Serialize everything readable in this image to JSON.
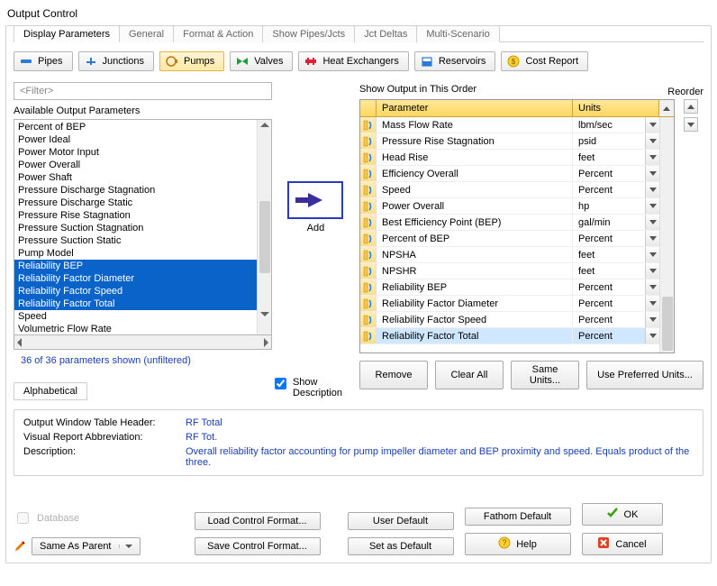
{
  "window": {
    "title": "Output Control"
  },
  "topTabs": [
    {
      "label": "Display Parameters",
      "active": true
    },
    {
      "label": "General",
      "active": false
    },
    {
      "label": "Format & Action",
      "active": false
    },
    {
      "label": "Show Pipes/Jcts",
      "active": false
    },
    {
      "label": "Jct Deltas",
      "active": false
    },
    {
      "label": "Multi-Scenario",
      "active": false
    }
  ],
  "categories": [
    {
      "label": "Pipes",
      "icon": "pipes-icon",
      "active": false
    },
    {
      "label": "Junctions",
      "icon": "junctions-icon",
      "active": false
    },
    {
      "label": "Pumps",
      "icon": "pump-icon",
      "active": true
    },
    {
      "label": "Valves",
      "icon": "valves-icon",
      "active": false
    },
    {
      "label": "Heat Exchangers",
      "icon": "heat-exchanger-icon",
      "active": false
    },
    {
      "label": "Reservoirs",
      "icon": "reservoir-icon",
      "active": false
    },
    {
      "label": "Cost Report",
      "icon": "cost-report-icon",
      "active": false
    }
  ],
  "filter": {
    "placeholder": "<Filter>"
  },
  "available": {
    "label": "Available Output Parameters",
    "items": [
      {
        "text": "Percent of BEP",
        "selected": false
      },
      {
        "text": "Power Ideal",
        "selected": false
      },
      {
        "text": "Power Motor Input",
        "selected": false
      },
      {
        "text": "Power Overall",
        "selected": false
      },
      {
        "text": "Power Shaft",
        "selected": false
      },
      {
        "text": "Pressure Discharge Stagnation",
        "selected": false
      },
      {
        "text": "Pressure Discharge Static",
        "selected": false
      },
      {
        "text": "Pressure Rise Stagnation",
        "selected": false
      },
      {
        "text": "Pressure Suction Stagnation",
        "selected": false
      },
      {
        "text": "Pressure Suction Static",
        "selected": false
      },
      {
        "text": "Pump Model",
        "selected": false
      },
      {
        "text": "Reliability BEP",
        "selected": true
      },
      {
        "text": "Reliability Factor Diameter",
        "selected": true
      },
      {
        "text": "Reliability Factor Speed",
        "selected": true
      },
      {
        "text": "Reliability Factor Total",
        "selected": true
      },
      {
        "text": "Speed",
        "selected": false
      },
      {
        "text": "Volumetric Flow Rate",
        "selected": false
      }
    ],
    "shownNote": "36 of 36 parameters shown (unfiltered)"
  },
  "alphaTab": {
    "label": "Alphabetical"
  },
  "addButton": {
    "label": "Add"
  },
  "showDescription": {
    "label": "Show Description",
    "checked": true
  },
  "order": {
    "label": "Show Output in This Order",
    "reorderLabel": "Reorder",
    "headers": {
      "parameter": "Parameter",
      "units": "Units"
    },
    "rows": [
      {
        "parameter": "Mass Flow Rate",
        "units": "lbm/sec",
        "highlight": false
      },
      {
        "parameter": "Pressure Rise Stagnation",
        "units": "psid",
        "highlight": false
      },
      {
        "parameter": "Head Rise",
        "units": "feet",
        "highlight": false
      },
      {
        "parameter": "Efficiency Overall",
        "units": "Percent",
        "highlight": false
      },
      {
        "parameter": "Speed",
        "units": "Percent",
        "highlight": false
      },
      {
        "parameter": "Power Overall",
        "units": "hp",
        "highlight": false
      },
      {
        "parameter": "Best Efficiency Point (BEP)",
        "units": "gal/min",
        "highlight": false
      },
      {
        "parameter": "Percent of BEP",
        "units": "Percent",
        "highlight": false
      },
      {
        "parameter": "NPSHA",
        "units": "feet",
        "highlight": false
      },
      {
        "parameter": "NPSHR",
        "units": "feet",
        "highlight": false
      },
      {
        "parameter": "Reliability BEP",
        "units": "Percent",
        "highlight": false
      },
      {
        "parameter": "Reliability Factor Diameter",
        "units": "Percent",
        "highlight": false
      },
      {
        "parameter": "Reliability Factor Speed",
        "units": "Percent",
        "highlight": false
      },
      {
        "parameter": "Reliability Factor Total",
        "units": "Percent",
        "highlight": true
      }
    ],
    "buttons": {
      "remove": "Remove",
      "clearAll": "Clear All",
      "sameUnits": "Same Units...",
      "usePreferred": "Use Preferred Units..."
    }
  },
  "description": {
    "headerLabel": "Output Window Table Header:",
    "headerValue": "RF Total",
    "abbrevLabel": "Visual Report Abbreviation:",
    "abbrevValue": "RF Tot.",
    "descLabel": "Description:",
    "descValue": "Overall reliability factor accounting for pump impeller diameter and BEP proximity and speed. Equals product of the three."
  },
  "bottom": {
    "database": "Database",
    "sameAsParent": "Same As Parent",
    "loadControl": "Load Control Format...",
    "saveControl": "Save Control Format...",
    "userDefault": "User Default",
    "setAsDefault": "Set as Default",
    "fathomDefault": "Fathom Default",
    "help": "Help",
    "ok": "OK",
    "cancel": "Cancel"
  }
}
